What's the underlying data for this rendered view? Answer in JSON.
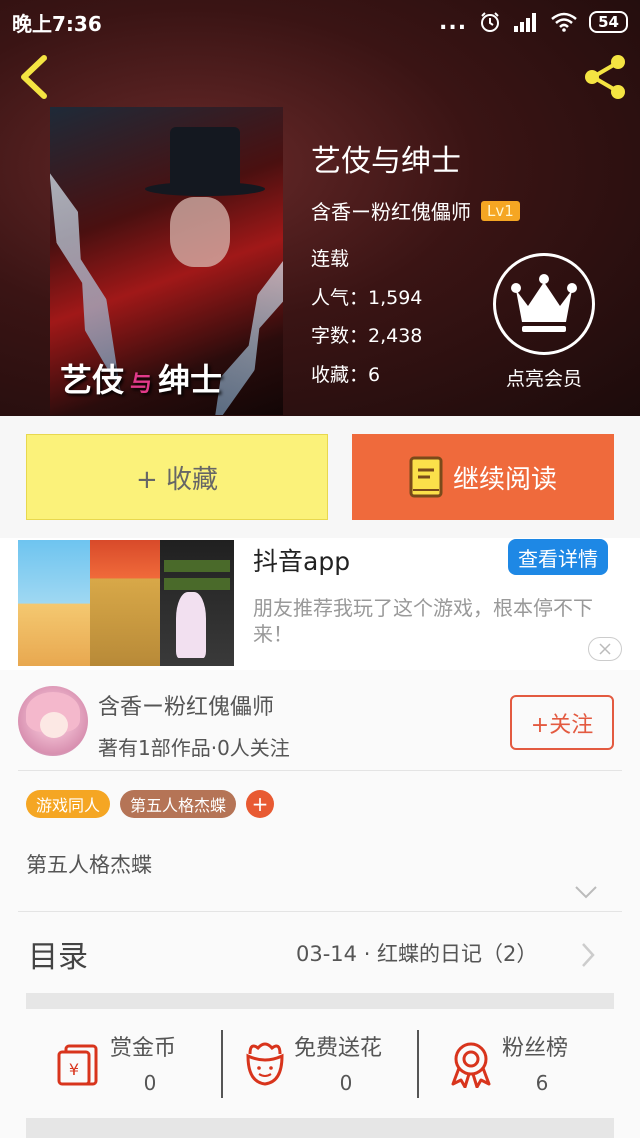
{
  "status_bar": {
    "time": "晚上7:36",
    "dots": "...",
    "battery": "54"
  },
  "book": {
    "cover_title_left": "艺伎",
    "cover_title_mid": "与",
    "cover_title_right": "绅士",
    "title": "艺伎与绅士",
    "author": "含香ー粉红傀儡师",
    "level": "Lv1",
    "status": "连载",
    "popularity": "人气：1,594",
    "words": "字数：2,438",
    "favorites": "收藏：6"
  },
  "vip": {
    "label": "点亮会员"
  },
  "actions": {
    "favorite_label": "+ 收藏",
    "read_label": "继续阅读"
  },
  "ad": {
    "name": "抖音app",
    "detail_button": "查看详情",
    "description": "朋友推荐我玩了这个游戏，根本停不下来！"
  },
  "author_card": {
    "name": "含香ー粉红傀儡师",
    "stats": "著有1部作品·0人关注",
    "follow_label": "+关注"
  },
  "tags": [
    "游戏同人",
    "第五人格杰蝶"
  ],
  "tag_add": "+",
  "intro": "第五人格杰蝶",
  "toc": {
    "label": "目录",
    "latest": "03-14 · 红蝶的日记（2）"
  },
  "stats": [
    {
      "name": "赏金币",
      "value": "0",
      "icon": "red-envelope-icon"
    },
    {
      "name": "免费送花",
      "value": "0",
      "icon": "flower-icon"
    },
    {
      "name": "粉丝榜",
      "value": "6",
      "icon": "medal-icon"
    }
  ],
  "colors": {
    "accent_orange": "#ef6a3c",
    "favorite_yellow": "#fbf27a",
    "ad_blue": "#1e88e5",
    "follow_red": "#e35a40",
    "icon_red": "#d8341c"
  }
}
